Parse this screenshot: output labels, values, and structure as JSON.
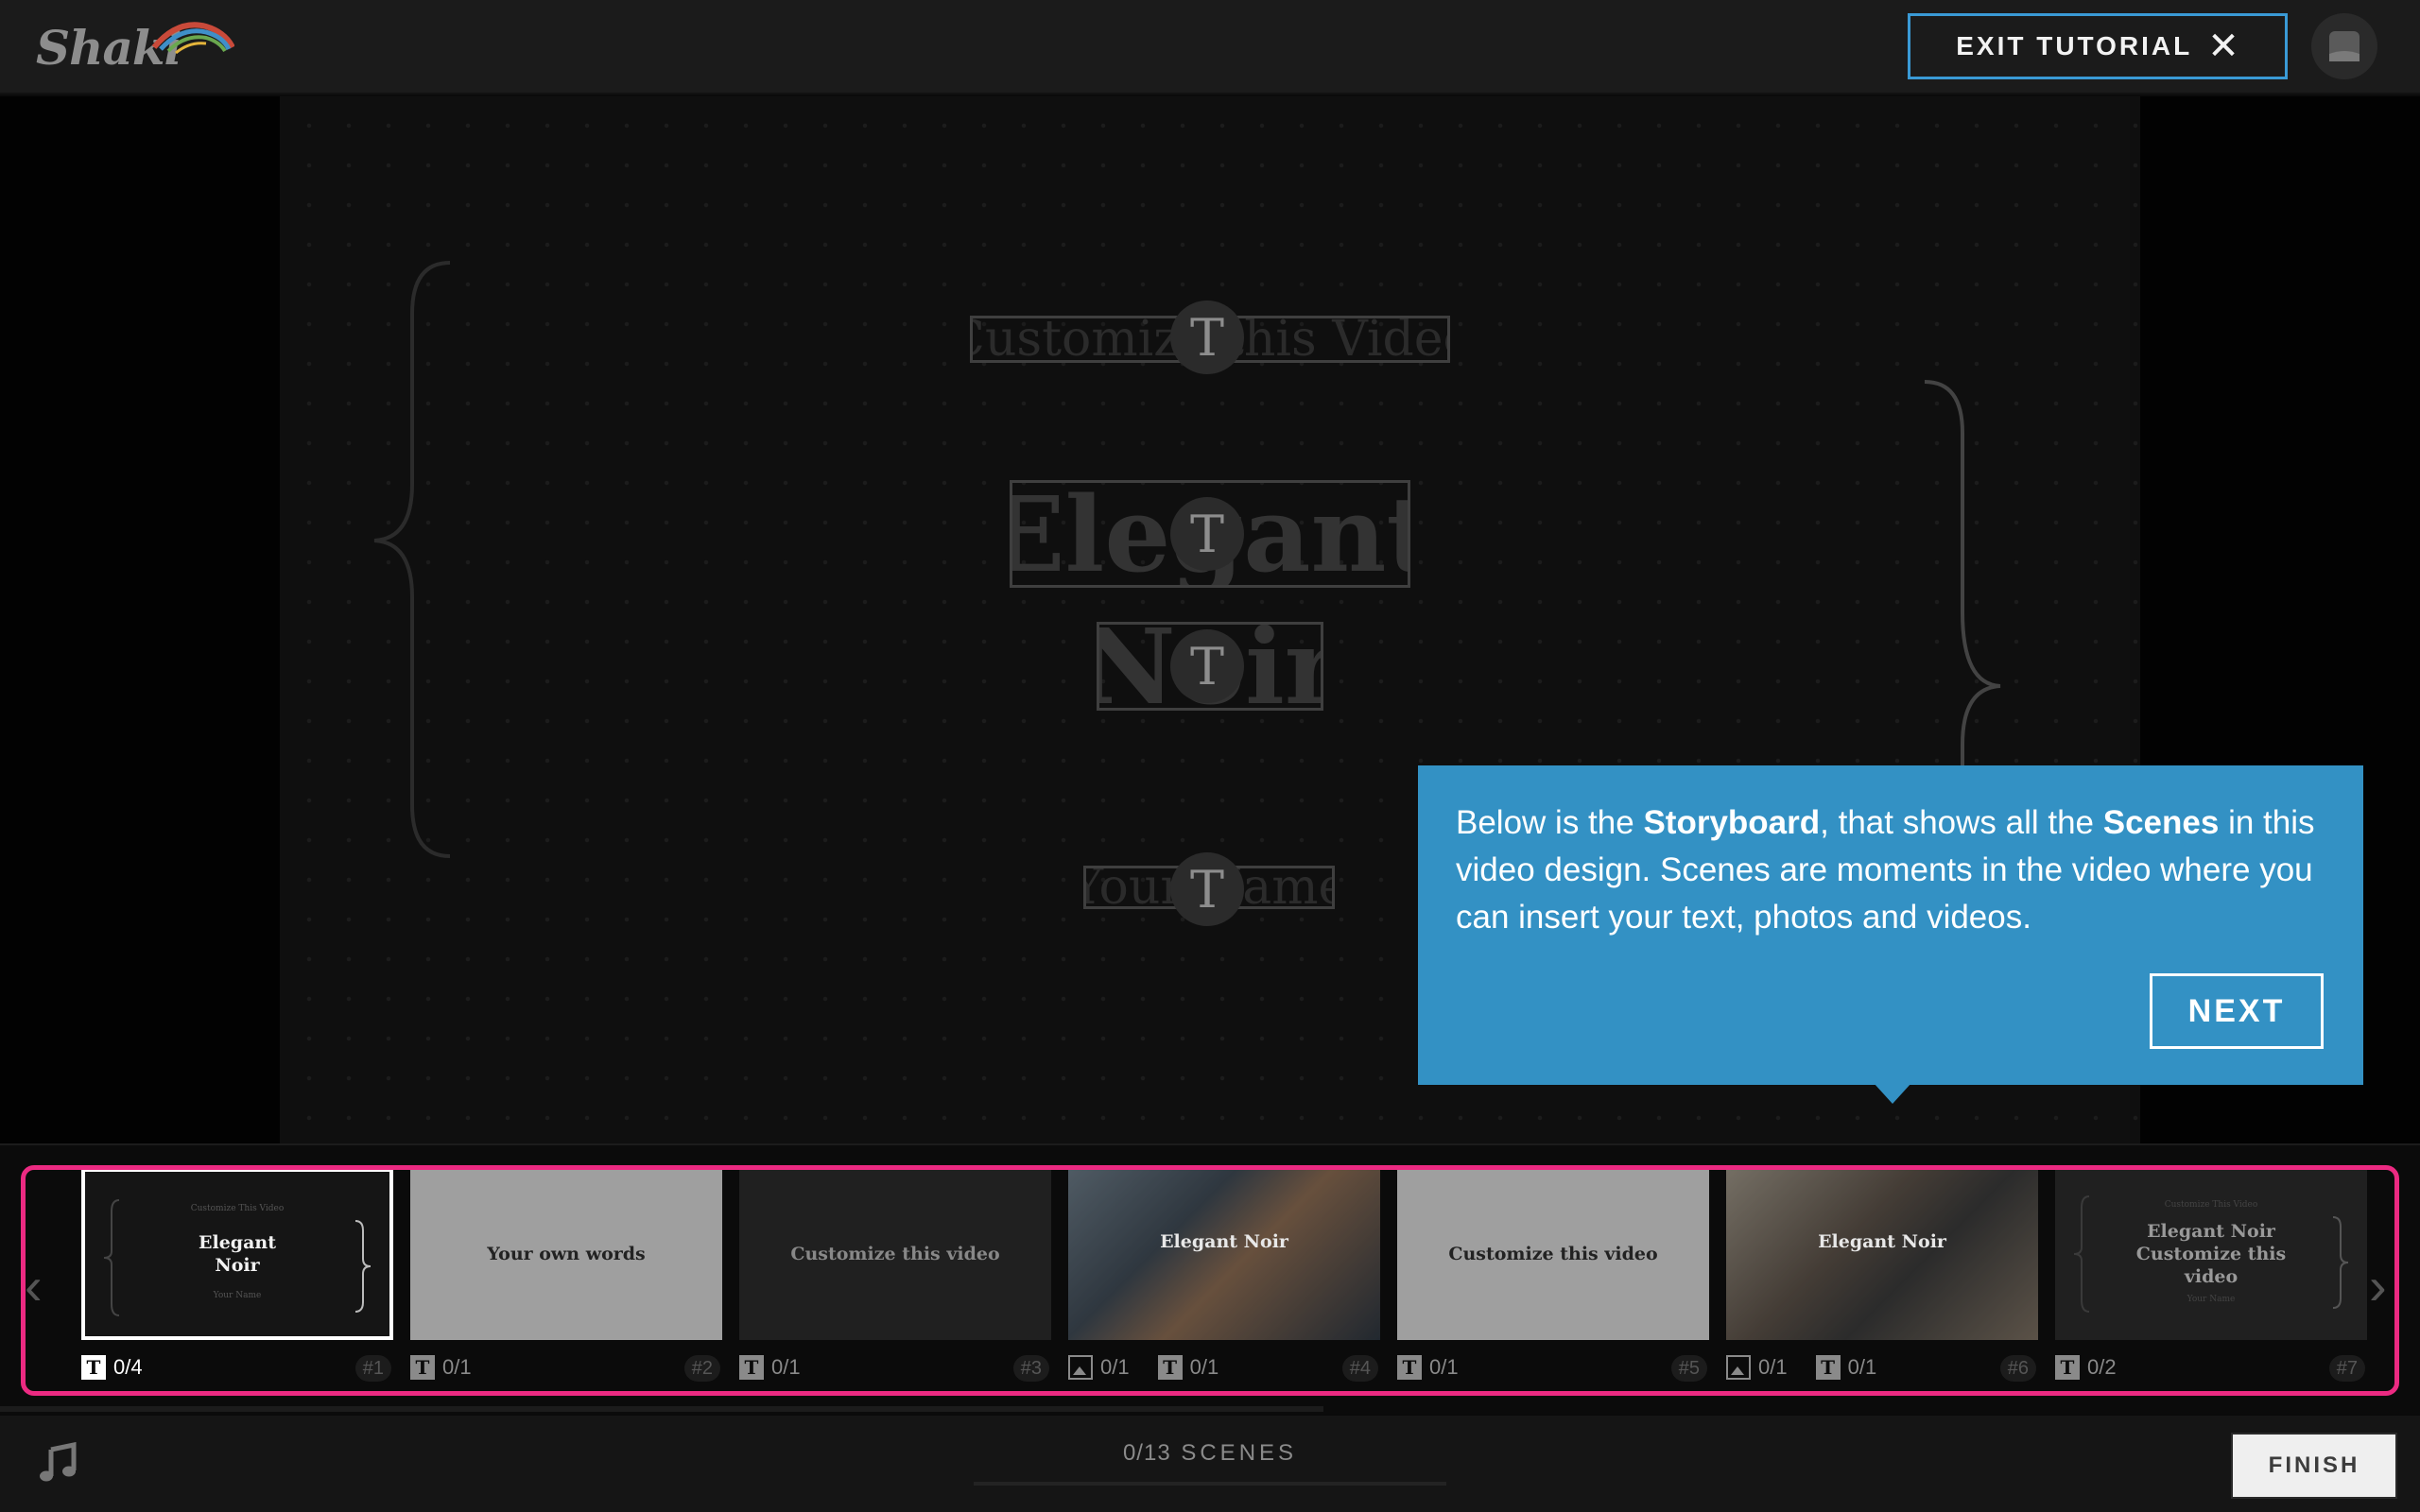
{
  "header": {
    "logo_text": "Shaki",
    "exit_label": "EXIT TUTORIAL",
    "exit_icon": "close-icon",
    "accent_color": "#3a9ad6"
  },
  "canvas": {
    "text_fields": [
      {
        "text": "Customize this Video",
        "icon": "T"
      },
      {
        "text": "Elegant",
        "icon": "T"
      },
      {
        "text": "Noir",
        "icon": "T"
      },
      {
        "text": "Your Name",
        "icon": "T"
      }
    ]
  },
  "tooltip": {
    "part1": "Below is the ",
    "bold1": "Storyboard",
    "part2": ", that shows all the ",
    "bold2": "Scenes",
    "part3": " in this video design. Scenes are moments in the video where you can insert your text, photos and videos.",
    "next_label": "NEXT",
    "color": "#3391c4"
  },
  "storyboard": {
    "highlight_color": "#ec2a82",
    "scenes": [
      {
        "top": "Customize This Video",
        "title": "Elegant Noir",
        "bottom": "Your Name",
        "photos": "",
        "texts": "0/4",
        "number": "#1"
      },
      {
        "top": "",
        "title": "Your own words",
        "bottom": "",
        "photos": "",
        "texts": "0/1",
        "number": "#2"
      },
      {
        "top": "",
        "title": "Customize this video",
        "bottom": "",
        "photos": "",
        "texts": "0/1",
        "number": "#3"
      },
      {
        "top": "",
        "title": "Elegant Noir",
        "bottom": "",
        "photos": "0/1",
        "texts": "0/1",
        "number": "#4"
      },
      {
        "top": "",
        "title": "Customize this video",
        "bottom": "",
        "photos": "",
        "texts": "0/1",
        "number": "#5"
      },
      {
        "top": "",
        "title": "Elegant Noir",
        "bottom": "",
        "photos": "0/1",
        "texts": "0/1",
        "number": "#6"
      },
      {
        "top": "Customize This Video",
        "title": "Elegant Noir Customize this video",
        "bottom": "Your Name",
        "photos": "",
        "texts": "0/2",
        "number": "#7"
      }
    ]
  },
  "footer": {
    "music_icon": "music-note-icon",
    "scenes_done": "0/13",
    "scenes_label": "SCENES",
    "finish_label": "FINISH"
  }
}
